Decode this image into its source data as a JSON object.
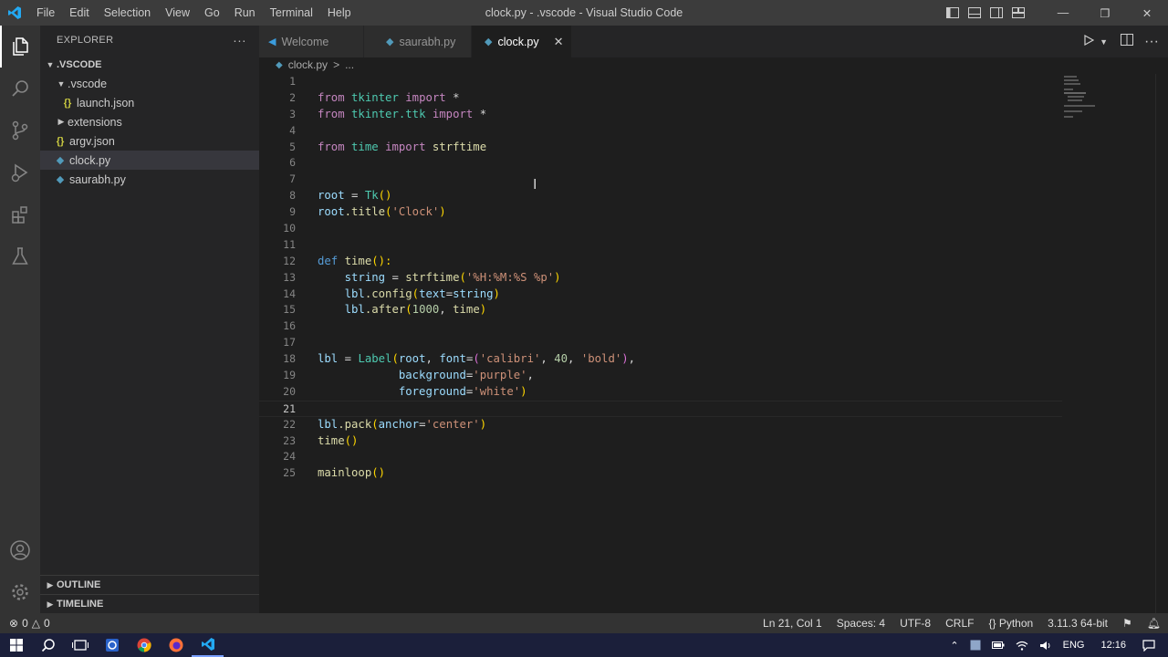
{
  "app": {
    "window_title": "clock.py - .vscode - Visual Studio Code",
    "menu": [
      "File",
      "Edit",
      "Selection",
      "View",
      "Go",
      "Run",
      "Terminal",
      "Help"
    ]
  },
  "colors": {
    "accent": "#007acc",
    "status_bar": "#333333",
    "taskbar": "#1b1f3a"
  },
  "sidebar": {
    "title": "EXPLORER",
    "more": "···",
    "root_label": ".VSCODE",
    "items": [
      {
        "label": ".vscode",
        "type": "folder",
        "expanded": true
      },
      {
        "label": "launch.json",
        "type": "json",
        "icon": "{}"
      },
      {
        "label": "extensions",
        "type": "folder",
        "expanded": false
      },
      {
        "label": "argv.json",
        "type": "json",
        "icon": "{}"
      },
      {
        "label": "clock.py",
        "type": "python",
        "selected": true
      },
      {
        "label": "saurabh.py",
        "type": "python"
      }
    ],
    "outline_label": "OUTLINE",
    "timeline_label": "TIMELINE"
  },
  "tabs": [
    {
      "label": "Welcome",
      "icon": "vscode-icon"
    },
    {
      "label": "saurabh.py",
      "icon": "python-icon"
    },
    {
      "label": "clock.py",
      "icon": "python-icon",
      "active": true,
      "close": "✕"
    }
  ],
  "breadcrumb": {
    "file": "clock.py",
    "separator": ">",
    "more": "..."
  },
  "code_lines": [
    "1",
    "2",
    "3",
    "4",
    "5",
    "6",
    "7",
    "8",
    "9",
    "10",
    "11",
    "12",
    "13",
    "14",
    "15",
    "16",
    "17",
    "18",
    "19",
    "20",
    "21",
    "22",
    "23",
    "24",
    "25"
  ],
  "code": {
    "l2": [
      "from",
      "tkinter",
      "import",
      "*"
    ],
    "l3": [
      "from",
      "tkinter.ttk",
      "import",
      "*"
    ],
    "l5": [
      "from",
      "time",
      "import",
      "strftime"
    ],
    "l8": [
      "root",
      "=",
      "Tk",
      "()"
    ],
    "l9": [
      "root",
      ".title",
      "(",
      "'Clock'",
      ")"
    ],
    "l12": [
      "def",
      "time",
      "():"
    ],
    "l13": [
      "string",
      "=",
      "strftime",
      "(",
      "'%H:%M:%S %p'",
      ")"
    ],
    "l14": [
      "lbl",
      ".config",
      "(",
      "text",
      "=",
      "string",
      ")"
    ],
    "l15": [
      "lbl",
      ".after",
      "(",
      "1000",
      ",",
      "time",
      ")"
    ],
    "l18": [
      "lbl",
      "=",
      "Label",
      "(",
      "root",
      ",",
      "font",
      "=",
      "(",
      "'calibri'",
      ",",
      "40",
      ",",
      "'bold'",
      ")",
      ","
    ],
    "l19": [
      "background",
      "=",
      "'purple'",
      ","
    ],
    "l20": [
      "foreground",
      "=",
      "'white'",
      ")"
    ],
    "l22": [
      "lbl",
      ".pack",
      "(",
      "anchor",
      "=",
      "'center'",
      ")"
    ],
    "l23": [
      "time",
      "()"
    ],
    "l25": [
      "mainloop",
      "()"
    ]
  },
  "status": {
    "errors": "0",
    "warnings": "0",
    "position": "Ln 21, Col 1",
    "spaces": "Spaces: 4",
    "encoding": "UTF-8",
    "eol": "CRLF",
    "language": "Python",
    "interpreter": "3.11.3 64-bit"
  },
  "taskbar": {
    "language": "ENG",
    "time": "12:16"
  }
}
